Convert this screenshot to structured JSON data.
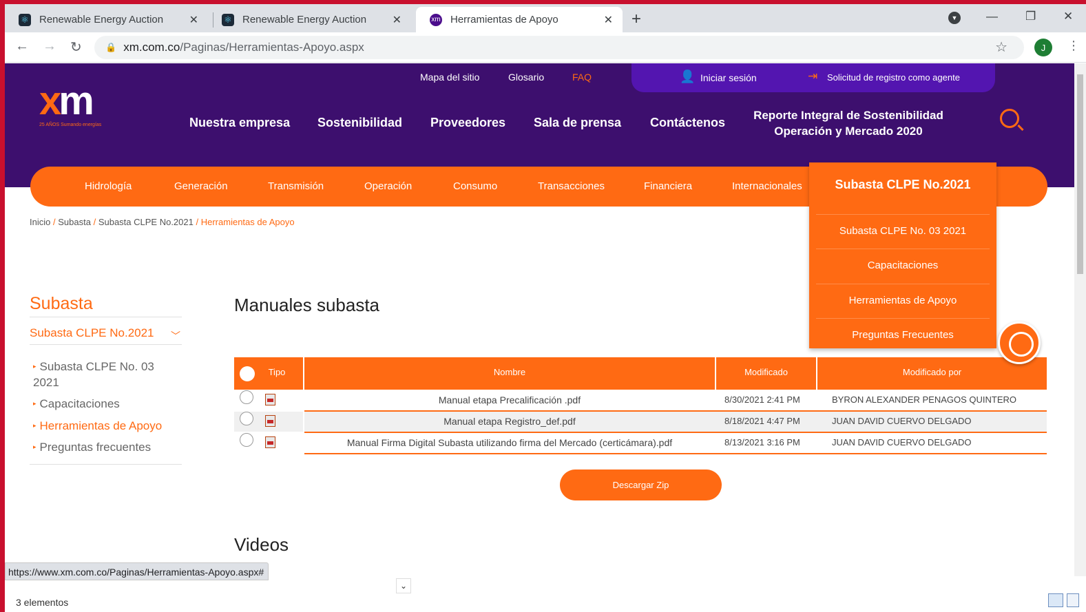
{
  "browser": {
    "tabs": [
      {
        "title": "Renewable Energy Auction",
        "active": false
      },
      {
        "title": "Renewable Energy Auction",
        "active": false
      },
      {
        "title": "Herramientas de Apoyo",
        "active": true
      }
    ],
    "url_host": "xm.com.co",
    "url_path": "/Paginas/Herramientas-Apoyo.aspx",
    "profile_initial": "J",
    "status_url": "https://www.xm.com.co/Paginas/Herramientas-Apoyo.aspx#"
  },
  "header": {
    "logo_text_x": "x",
    "logo_text_m": "m",
    "logo_tagline": "25 AÑOS  Sumando energías",
    "top_links": [
      "Mapa del sitio",
      "Glosario",
      "FAQ"
    ],
    "login": "Iniciar sesión",
    "register": "Solicitud de registro como agente",
    "main_nav": [
      "Nuestra empresa",
      "Sostenibilidad",
      "Proveedores",
      "Sala de prensa",
      "Contáctenos"
    ],
    "report_line1": "Reporte Integral de Sostenibilidad",
    "report_line2": "Operación y Mercado 2020",
    "accent_color": "#ff6a13",
    "brand_color": "#3d0f6e"
  },
  "orange_nav": [
    "Hidrología",
    "Generación",
    "Transmisión",
    "Operación",
    "Consumo",
    "Transacciones",
    "Financiera",
    "Internacionales"
  ],
  "dropdown": {
    "title": "Subasta CLPE No.2021",
    "items": [
      "Subasta CLPE No. 03 2021",
      "Capacitaciones",
      "Herramientas de Apoyo",
      "Preguntas Frecuentes"
    ]
  },
  "breadcrumb": {
    "items": [
      "Inicio",
      "Subasta",
      "Subasta CLPE No.2021"
    ],
    "current": "Herramientas de Apoyo",
    "separator": "/"
  },
  "sidebar": {
    "title": "Subasta",
    "section": "Subasta CLPE No.2021",
    "items": [
      "Subasta CLPE No. 03 2021",
      "Capacitaciones",
      "Herramientas de Apoyo",
      "Preguntas frecuentes"
    ]
  },
  "main": {
    "heading": "Manuales subasta",
    "columns": [
      "Tipo",
      "Nombre",
      "Modificado",
      "Modificado por"
    ],
    "rows": [
      {
        "name": "Manual etapa Precalificación .pdf",
        "modified": "8/30/2021 2:41 PM",
        "by": "BYRON ALEXANDER PENAGOS QUINTERO"
      },
      {
        "name": "Manual etapa Registro_def.pdf",
        "modified": "8/18/2021 4:47 PM",
        "by": "JUAN DAVID CUERVO DELGADO"
      },
      {
        "name": "Manual Firma Digital Subasta utilizando firma del Mercado (certicámara).pdf",
        "modified": "8/13/2021 3:16 PM",
        "by": "JUAN DAVID CUERVO DELGADO"
      }
    ],
    "download_button": "Descargar Zip",
    "videos_heading": "Videos"
  },
  "footer": {
    "items_count": "3 elementos"
  }
}
